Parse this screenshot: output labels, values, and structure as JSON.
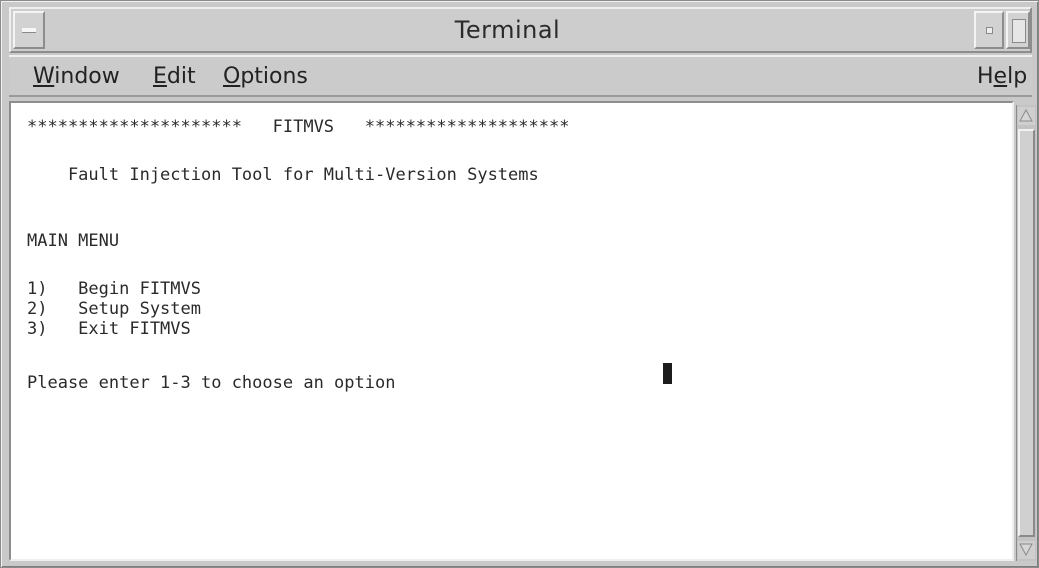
{
  "window": {
    "title": "Terminal"
  },
  "menubar": {
    "window": {
      "mnemonic": "W",
      "rest": "indow"
    },
    "edit": {
      "mnemonic": "E",
      "rest": "dit"
    },
    "options": {
      "mnemonic": "O",
      "rest": "ptions"
    },
    "help": {
      "pre": "H",
      "mnemonic": "e",
      "rest": "lp"
    }
  },
  "terminal": {
    "banner": "*********************   FITMVS   ********************",
    "subtitle": "    Fault Injection Tool for Multi-Version Systems",
    "menu_heading": "MAIN MENU",
    "options": [
      "1)   Begin FITMVS",
      "2)   Setup System",
      "3)   Exit FITMVS"
    ],
    "prompt": "Please enter 1-3 to choose an option"
  }
}
